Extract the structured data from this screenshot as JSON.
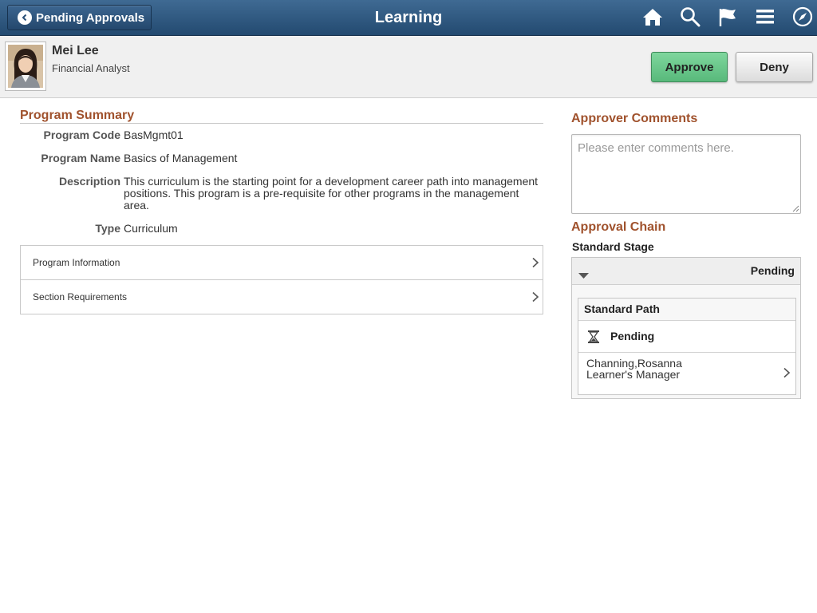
{
  "header": {
    "back_label": "Pending Approvals",
    "title": "Learning",
    "icons": [
      "home-icon",
      "search-icon",
      "flag-icon",
      "menu-icon",
      "compass-icon"
    ]
  },
  "user": {
    "name": "Mei Lee",
    "job_title": "Financial Analyst"
  },
  "actions": {
    "approve_label": "Approve",
    "deny_label": "Deny"
  },
  "program_summary": {
    "title": "Program Summary",
    "fields": [
      {
        "label": "Program Code",
        "value": "BasMgmt01"
      },
      {
        "label": "Program Name",
        "value": "Basics of Management"
      },
      {
        "label": "Description",
        "value": "This curriculum is the starting point for a development career path into management positions. This program is a pre-requisite for other programs in the management area."
      },
      {
        "label": "Type",
        "value": "Curriculum"
      }
    ],
    "collapsibles": [
      {
        "label": "Program Information"
      },
      {
        "label": "Section Requirements"
      }
    ]
  },
  "approver_comments": {
    "title": "Approver Comments",
    "placeholder": "Please enter comments here.",
    "value": ""
  },
  "approval_chain": {
    "title": "Approval Chain",
    "stage_label": "Standard Stage",
    "stage_status": "Pending",
    "path": {
      "title": "Standard Path",
      "status": "Pending",
      "approver_name": "Channing,Rosanna",
      "approver_role": "Learner's Manager"
    }
  },
  "colors": {
    "banner": "#2f5880",
    "section_title": "#a0522d",
    "approve_button": "#6cc98c"
  }
}
